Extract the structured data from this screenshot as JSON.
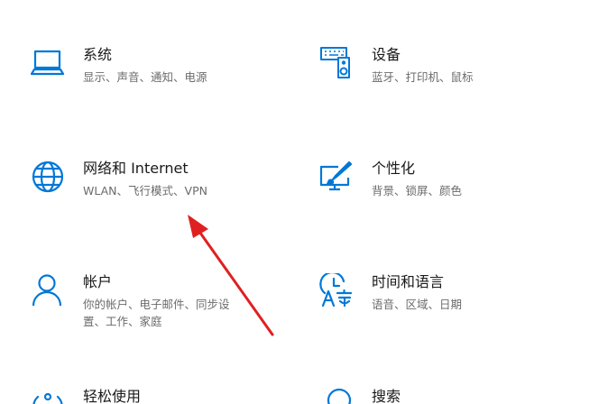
{
  "settings": {
    "tiles": [
      {
        "title": "系统",
        "desc_line1": "显示、声音、通知、电源",
        "icon": "laptop-icon"
      },
      {
        "title": "设备",
        "desc_line1": "蓝牙、打印机、鼠标",
        "icon": "keyboard-speaker-icon"
      },
      {
        "title": "网络和 Internet",
        "desc_line1": "WLAN、飞行模式、VPN",
        "icon": "globe-icon"
      },
      {
        "title": "个性化",
        "desc_line1": "背景、锁屏、颜色",
        "icon": "paintbrush-monitor-icon"
      },
      {
        "title": "帐户",
        "desc_line1": "你的帐户、电子邮件、同步设",
        "desc_line2": "置、工作、家庭",
        "icon": "person-icon"
      },
      {
        "title": "时间和语言",
        "desc_line1": "语音、区域、日期",
        "icon": "clock-language-icon"
      },
      {
        "title": "轻松使用",
        "icon": "ease-of-access-icon"
      },
      {
        "title": "搜索",
        "icon": "search-icon"
      }
    ]
  },
  "colors": {
    "accent": "#0078d7",
    "title": "#1a1a1a",
    "description": "#6b6b6b",
    "annotation_arrow": "#e02020"
  }
}
